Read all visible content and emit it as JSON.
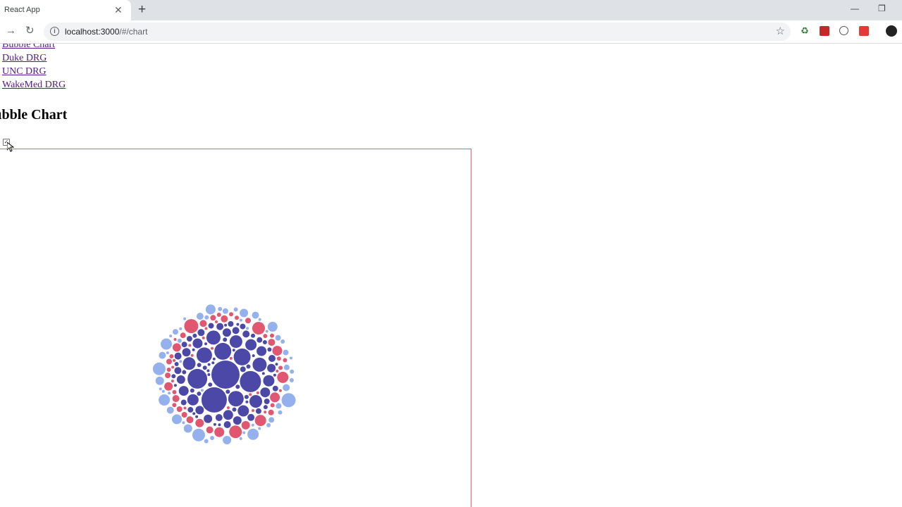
{
  "browser": {
    "tab_title": "React App",
    "url_host": "localhost:3000",
    "url_path": "/#/chart"
  },
  "nav_links": [
    "Bubble Chart",
    "Duke DRG",
    "UNC DRG",
    "WakeMed DRG"
  ],
  "page_heading": "Bubble Chart",
  "colors": {
    "inner": "#4b48a8",
    "middle": "#e15670",
    "outer": "#94b1ed",
    "frame_border": "#e06666",
    "link": "#551a8b"
  },
  "chart_data": {
    "type": "bubble",
    "title": "",
    "series": [
      {
        "color": "#4b48a8",
        "values": [
          20,
          18,
          15,
          14,
          12,
          12,
          11,
          11,
          10,
          10,
          9,
          9,
          9,
          8,
          8,
          8,
          8,
          7,
          7,
          7,
          7,
          7,
          6,
          6,
          6,
          6,
          6,
          6,
          6,
          5,
          5,
          5,
          5,
          5,
          5,
          5,
          5,
          5,
          5,
          4,
          4,
          4,
          4,
          4,
          4,
          4,
          4,
          4,
          4,
          4,
          4,
          3,
          3,
          3,
          3,
          3,
          3,
          3,
          3,
          3,
          3,
          3,
          3,
          3,
          3,
          3,
          3,
          3,
          3,
          3,
          2,
          2,
          2,
          2,
          2,
          2,
          2,
          2,
          2,
          2,
          2,
          2,
          2,
          2,
          2,
          2,
          2,
          2,
          2,
          2
        ]
      },
      {
        "color": "#e15670",
        "values": [
          10,
          9,
          9,
          8,
          8,
          7,
          7,
          7,
          6,
          6,
          6,
          6,
          5,
          5,
          5,
          5,
          5,
          5,
          4,
          4,
          4,
          4,
          4,
          4,
          4,
          4,
          3,
          3,
          3,
          3,
          3,
          3,
          3,
          3,
          3,
          3,
          3,
          3,
          3,
          2,
          2,
          2,
          2,
          2,
          2,
          2,
          2,
          2,
          2,
          2,
          2,
          2,
          2,
          2,
          2,
          2,
          2,
          2
        ]
      },
      {
        "color": "#94b1ed",
        "values": [
          10,
          9,
          9,
          8,
          8,
          8,
          7,
          7,
          7,
          6,
          6,
          6,
          6,
          5,
          5,
          5,
          5,
          5,
          4,
          4,
          4,
          4,
          4,
          4,
          4,
          3,
          3,
          3,
          3,
          3,
          3,
          3,
          3,
          3,
          3,
          3,
          2,
          2,
          2,
          2,
          2,
          2,
          2,
          2,
          2,
          2,
          2,
          2,
          2,
          2,
          2,
          2,
          2,
          2,
          2
        ]
      }
    ]
  }
}
